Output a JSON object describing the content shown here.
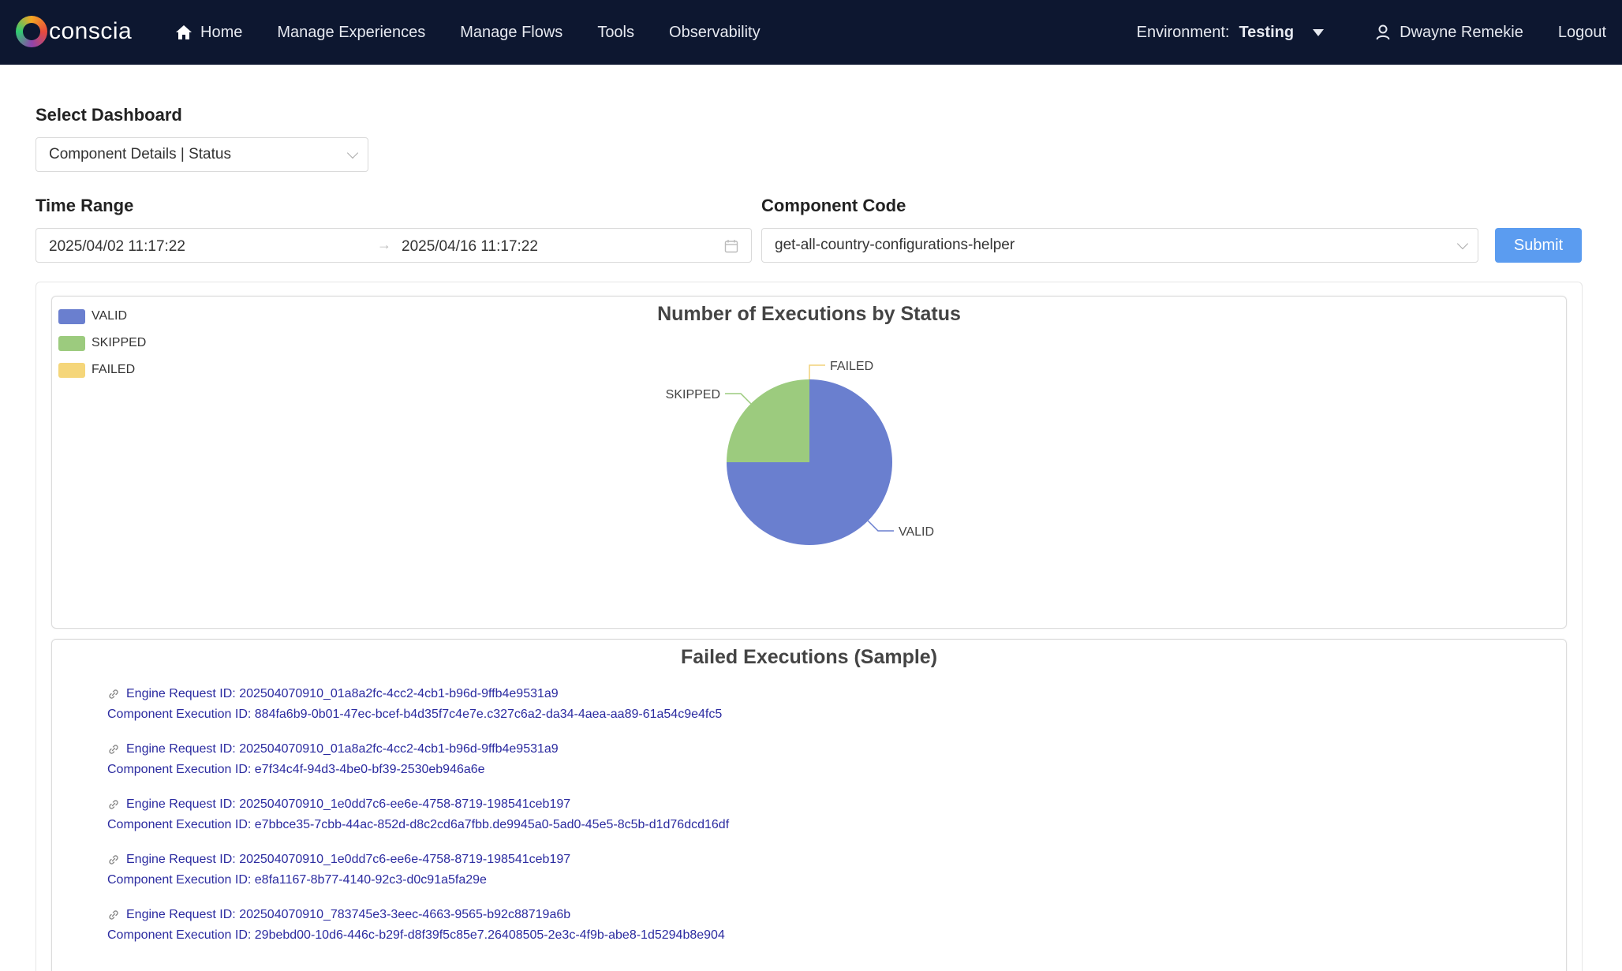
{
  "navbar": {
    "logo_text": "conscia",
    "items": [
      {
        "label": "Home",
        "icon": "home-icon"
      },
      {
        "label": "Manage Experiences"
      },
      {
        "label": "Manage Flows"
      },
      {
        "label": "Tools"
      },
      {
        "label": "Observability"
      }
    ],
    "environment_label": "Environment:",
    "environment_value": "Testing",
    "user_name": "Dwayne Remekie",
    "user_icon": "user-icon",
    "logout_label": "Logout"
  },
  "form": {
    "dashboard_label": "Select Dashboard",
    "dashboard_value": "Component Details | Status",
    "time_range_label": "Time Range",
    "time_range_start": "2025/04/02 11:17:22",
    "time_range_arrow": "→",
    "time_range_end": "2025/04/16 11:17:22",
    "component_code_label": "Component Code",
    "component_code_value": "get-all-country-configurations-helper",
    "submit_label": "Submit"
  },
  "colors": {
    "nav_bg": "#0d1730",
    "valid": "#6a7fcf",
    "skipped": "#9ccb7e",
    "failed": "#f5d67a",
    "submit": "#5b9cf0",
    "link": "#2b2ba0"
  },
  "chart_data": {
    "type": "pie",
    "title": "Number of Executions by Status",
    "legend_position": "top-left",
    "categories": [
      "VALID",
      "SKIPPED",
      "FAILED"
    ],
    "values": [
      75,
      25,
      0
    ]
  },
  "failed_executions": {
    "title": "Failed Executions (Sample)",
    "items": [
      {
        "engine_request": "Engine Request ID: 202504070910_01a8a2fc-4cc2-4cb1-b96d-9ffb4e9531a9",
        "component_execution": "Component Execution ID: 884fa6b9-0b01-47ec-bcef-b4d35f7c4e7e.c327c6a2-da34-4aea-aa89-61a54c9e4fc5"
      },
      {
        "engine_request": "Engine Request ID: 202504070910_01a8a2fc-4cc2-4cb1-b96d-9ffb4e9531a9",
        "component_execution": "Component Execution ID: e7f34c4f-94d3-4be0-bf39-2530eb946a6e"
      },
      {
        "engine_request": "Engine Request ID: 202504070910_1e0dd7c6-ee6e-4758-8719-198541ceb197",
        "component_execution": "Component Execution ID: e7bbce35-7cbb-44ac-852d-d8c2cd6a7fbb.de9945a0-5ad0-45e5-8c5b-d1d76dcd16df"
      },
      {
        "engine_request": "Engine Request ID: 202504070910_1e0dd7c6-ee6e-4758-8719-198541ceb197",
        "component_execution": "Component Execution ID: e8fa1167-8b77-4140-92c3-d0c91a5fa29e"
      },
      {
        "engine_request": "Engine Request ID: 202504070910_783745e3-3eec-4663-9565-b92c88719a6b",
        "component_execution": "Component Execution ID: 29bebd00-10d6-446c-b29f-d8f39f5c85e7.26408505-2e3c-4f9b-abe8-1d5294b8e904"
      }
    ]
  }
}
